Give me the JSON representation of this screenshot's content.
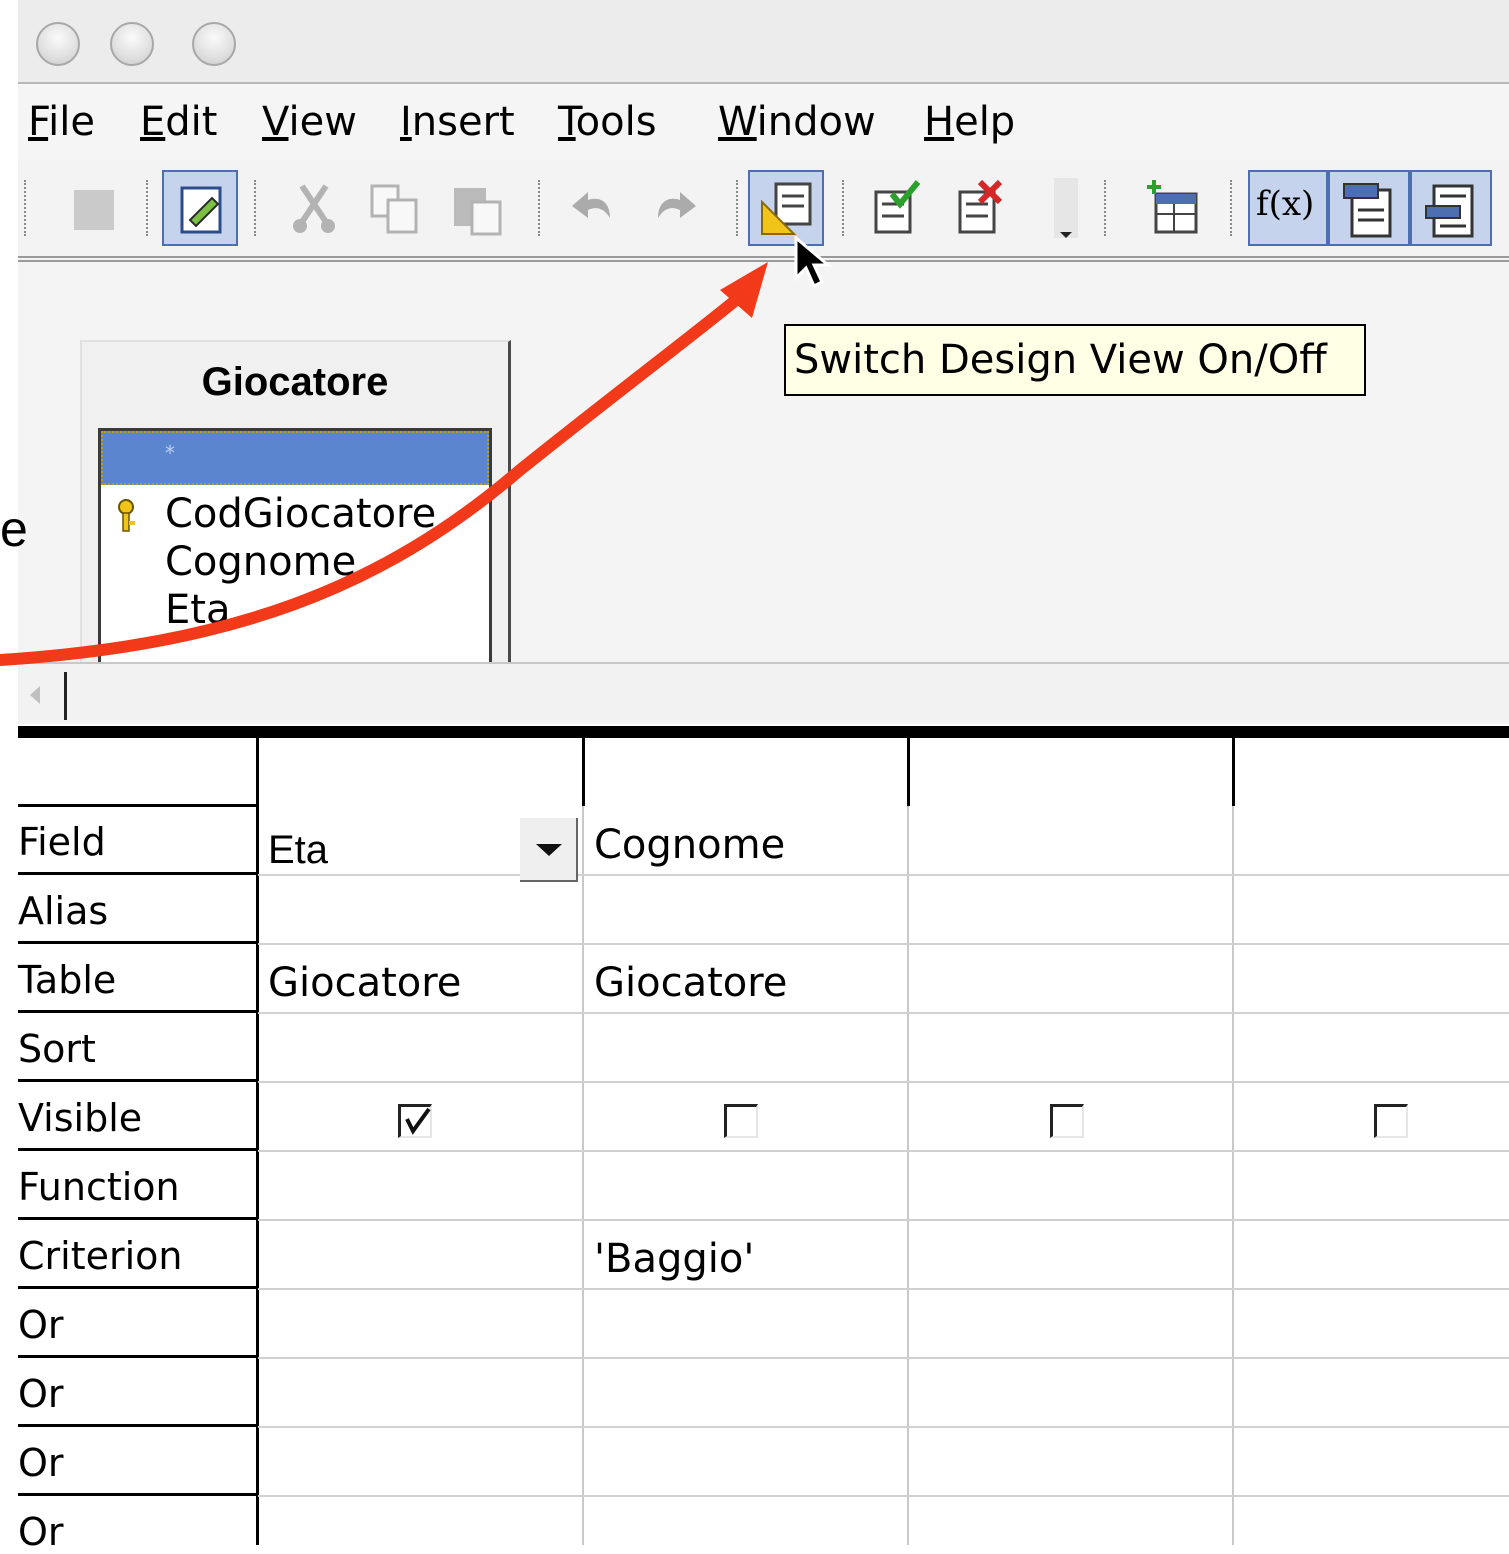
{
  "menubar": {
    "items": [
      {
        "label": "File",
        "key": "F",
        "rest": "ile"
      },
      {
        "label": "Edit",
        "key": "E",
        "rest": "dit"
      },
      {
        "label": "View",
        "key": "V",
        "rest": "iew"
      },
      {
        "label": "Insert",
        "key": "I",
        "rest": "nsert"
      },
      {
        "label": "Tools",
        "key": "T",
        "rest": "ools"
      },
      {
        "label": "Window",
        "key": "W",
        "rest": "indow"
      },
      {
        "label": "Help",
        "key": "H",
        "rest": "elp"
      }
    ]
  },
  "toolbar": {
    "buttons": [
      {
        "icon": "save-icon",
        "state": "disabled"
      },
      {
        "icon": "edit-icon",
        "state": "active"
      },
      {
        "icon": "cut-icon",
        "state": "disabled"
      },
      {
        "icon": "copy-icon",
        "state": "disabled"
      },
      {
        "icon": "paste-icon",
        "state": "disabled"
      },
      {
        "icon": "undo-icon",
        "state": "disabled"
      },
      {
        "icon": "redo-icon",
        "state": "disabled"
      },
      {
        "icon": "design-view-icon",
        "state": "active"
      },
      {
        "icon": "run-query-icon",
        "state": "normal"
      },
      {
        "icon": "clear-query-icon",
        "state": "normal"
      },
      {
        "icon": "add-table-icon",
        "state": "normal"
      },
      {
        "icon": "functions-icon",
        "state": "active",
        "text": "f(x)"
      },
      {
        "icon": "table-name-icon",
        "state": "active"
      },
      {
        "icon": "alias-icon",
        "state": "active"
      }
    ]
  },
  "tooltip": {
    "text": "Switch Design View On/Off"
  },
  "table_window": {
    "title": "Giocatore",
    "star": "*",
    "fields": [
      "CodGiocatore",
      "Cognome",
      "Eta"
    ]
  },
  "left_fragment": "e",
  "grid": {
    "row_labels": [
      "Field",
      "Alias",
      "Table",
      "Sort",
      "Visible",
      "Function",
      "Criterion",
      "Or",
      "Or",
      "Or",
      "Or"
    ],
    "columns": [
      {
        "field": "Eta",
        "alias": "",
        "table": "Giocatore",
        "sort": "",
        "visible": true,
        "function": "",
        "criterion": ""
      },
      {
        "field": "Cognome",
        "alias": "",
        "table": "Giocatore",
        "sort": "",
        "visible": false,
        "function": "",
        "criterion": "'Baggio'"
      },
      {
        "field": "",
        "alias": "",
        "table": "",
        "sort": "",
        "visible": false,
        "function": "",
        "criterion": ""
      },
      {
        "field": "",
        "alias": "",
        "table": "",
        "sort": "",
        "visible": false,
        "function": "",
        "criterion": ""
      }
    ]
  },
  "colors": {
    "annotation_arrow": "#f23a1a",
    "highlight": "#5b86cf",
    "tooltip_bg": "#ffffe6"
  }
}
